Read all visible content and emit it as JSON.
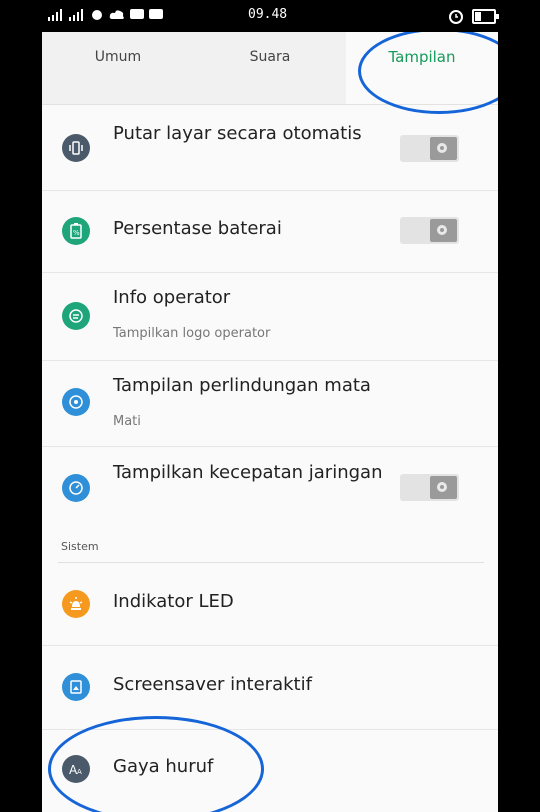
{
  "status_bar": {
    "left_text": ".ıl ᵢ ᵢil ",
    "time": "09.48"
  },
  "tabs": [
    {
      "label": "Umum"
    },
    {
      "label": "Suara"
    },
    {
      "label": "Tampilan"
    }
  ],
  "settings": [
    {
      "title": "Putar layar secara otomatis",
      "subtitle": "",
      "toggle": "off",
      "icon": "screen-rotate-icon",
      "color": "#4a5a6a"
    },
    {
      "title": "Persentase baterai",
      "subtitle": "",
      "toggle": "off",
      "icon": "battery-icon",
      "color": "#1fa57a"
    },
    {
      "title": "Info operator",
      "subtitle": "Tampilkan logo operator",
      "toggle": null,
      "icon": "operator-icon",
      "color": "#1fa57a"
    },
    {
      "title": "Tampilan perlindungan mata",
      "subtitle": "Mati",
      "toggle": null,
      "icon": "eye-protection-icon",
      "color": "#2f8fd8"
    },
    {
      "title": "Tampilkan kecepatan jaringan",
      "subtitle": "",
      "toggle": "off",
      "icon": "speed-icon",
      "color": "#2f8fd8"
    }
  ],
  "section_label": "Sistem",
  "system_settings": [
    {
      "title": "Indikator LED",
      "icon": "led-icon",
      "color": "#f59a1e"
    },
    {
      "title": "Screensaver interaktif",
      "icon": "screensaver-icon",
      "color": "#2f8fd8"
    },
    {
      "title": "Gaya huruf",
      "icon": "font-icon",
      "color": "#4a5a6a"
    }
  ],
  "annotation_color": "#1565d8"
}
